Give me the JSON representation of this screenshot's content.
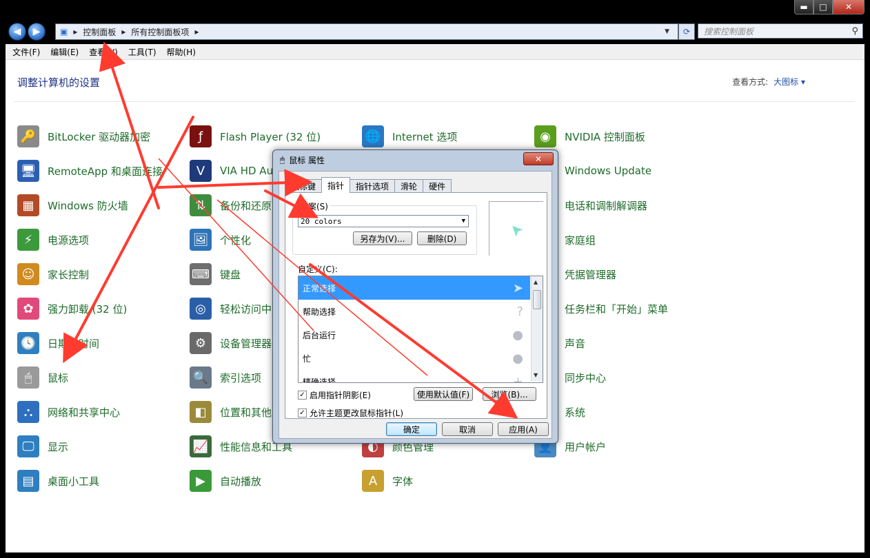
{
  "window": {
    "min_glyph": "▬",
    "max_glyph": "□",
    "close_glyph": "✕"
  },
  "nav": {
    "back_glyph": "◀",
    "forward_glyph": "▶",
    "refresh_glyph": "⟳",
    "breadcrumb": [
      "控制面板",
      "所有控制面板项"
    ],
    "search_placeholder": "搜索控制面板"
  },
  "menu": [
    "文件(F)",
    "编辑(E)",
    "查看(V)",
    "工具(T)",
    "帮助(H)"
  ],
  "header": {
    "title": "调整计算机的设置",
    "view_label": "查看方式:",
    "view_value": "大图标 ▾"
  },
  "items": [
    {
      "label": "BitLocker 驱动器加密",
      "icon": "key-lock-icon",
      "glyph": "🔑",
      "color": "#8a8a8a"
    },
    {
      "label": "Flash Player (32 位)",
      "icon": "flash-icon",
      "glyph": "ƒ",
      "color": "#7a1010"
    },
    {
      "label": "Internet 选项",
      "icon": "globe-icon",
      "glyph": "🌐",
      "color": "#2a78c4"
    },
    {
      "label": "NVIDIA 控制面板",
      "icon": "nvidia-icon",
      "glyph": "◉",
      "color": "#5a9e1c"
    },
    {
      "label": "RemoteApp 和桌面连接",
      "icon": "remote-desktop-icon",
      "glyph": "🖥",
      "color": "#2b5fb3"
    },
    {
      "label": "VIA HD Au",
      "icon": "via-audio-icon",
      "glyph": "V",
      "color": "#1f3a7a"
    },
    {
      "label": "",
      "icon": "hidden-icon",
      "glyph": "",
      "color": "#ffffff"
    },
    {
      "label": "Windows Update",
      "icon": "windows-update-icon",
      "glyph": "⟲",
      "color": "#4b8a2c"
    },
    {
      "label": "Windows 防火墙",
      "icon": "firewall-icon",
      "glyph": "▦",
      "color": "#b34a26"
    },
    {
      "label": "备份和还原",
      "icon": "backup-icon",
      "glyph": "⇅",
      "color": "#3f8c3f"
    },
    {
      "label": "",
      "icon": "hidden-icon",
      "glyph": "",
      "color": "#ffffff"
    },
    {
      "label": "电话和调制解调器",
      "icon": "phone-icon",
      "glyph": "☎",
      "color": "#777777"
    },
    {
      "label": "电源选项",
      "icon": "power-icon",
      "glyph": "⚡",
      "color": "#3c9a3c"
    },
    {
      "label": "个性化",
      "icon": "personalize-icon",
      "glyph": "🖼",
      "color": "#2e74b8"
    },
    {
      "label": "",
      "icon": "hidden-icon",
      "glyph": "",
      "color": "#ffffff"
    },
    {
      "label": "家庭组",
      "icon": "homegroup-icon",
      "glyph": "⌂",
      "color": "#2f7fc0"
    },
    {
      "label": "家长控制",
      "icon": "parental-icon",
      "glyph": "☺",
      "color": "#d18a1e"
    },
    {
      "label": "键盘",
      "icon": "keyboard-icon",
      "glyph": "⌨",
      "color": "#6e6e6e"
    },
    {
      "label": "",
      "icon": "hidden-icon",
      "glyph": "",
      "color": "#ffffff"
    },
    {
      "label": "凭据管理器",
      "icon": "credential-icon",
      "glyph": "🗝",
      "color": "#b88a2a"
    },
    {
      "label": "强力卸载 (32 位)",
      "icon": "uninstall-icon",
      "glyph": "✿",
      "color": "#e04a7a"
    },
    {
      "label": "轻松访问中",
      "icon": "ease-access-icon",
      "glyph": "◎",
      "color": "#2a5fa8"
    },
    {
      "label": "",
      "icon": "hidden-icon",
      "glyph": "",
      "color": "#ffffff"
    },
    {
      "label": "任务栏和「开始」菜单",
      "icon": "taskbar-icon",
      "glyph": "▭",
      "color": "#4a6a9a"
    },
    {
      "label": "日期和时间",
      "icon": "clock-icon",
      "glyph": "🕓",
      "color": "#2f7fc0"
    },
    {
      "label": "设备管理器",
      "icon": "device-manager-icon",
      "glyph": "⚙",
      "color": "#6a6a6a"
    },
    {
      "label": "",
      "icon": "hidden-icon",
      "glyph": "",
      "color": "#ffffff"
    },
    {
      "label": "声音",
      "icon": "sound-icon",
      "glyph": "♪",
      "color": "#7a7a7a"
    },
    {
      "label": "鼠标",
      "icon": "mouse-icon",
      "glyph": "🖱",
      "color": "#9a9a9a"
    },
    {
      "label": "索引选项",
      "icon": "index-icon",
      "glyph": "🔍",
      "color": "#6a7a8a"
    },
    {
      "label": "",
      "icon": "hidden-icon",
      "glyph": "",
      "color": "#ffffff"
    },
    {
      "label": "同步中心",
      "icon": "sync-icon",
      "glyph": "⟳",
      "color": "#3a9a3a"
    },
    {
      "label": "网络和共享中心",
      "icon": "network-icon",
      "glyph": "⛬",
      "color": "#2f6fc0"
    },
    {
      "label": "位置和其他",
      "icon": "location-icon",
      "glyph": "◧",
      "color": "#9a8a3a"
    },
    {
      "label": "",
      "icon": "hidden-icon",
      "glyph": "",
      "color": "#ffffff"
    },
    {
      "label": "系统",
      "icon": "system-icon",
      "glyph": "▣",
      "color": "#4a7ab0"
    },
    {
      "label": "显示",
      "icon": "display-icon",
      "glyph": "🖵",
      "color": "#2f7fc0"
    },
    {
      "label": "性能信息和工具",
      "icon": "performance-icon",
      "glyph": "📈",
      "color": "#3a6a3a"
    },
    {
      "label": "颜色管理",
      "icon": "color-icon",
      "glyph": "◐",
      "color": "#c04040"
    },
    {
      "label": "用户帐户",
      "icon": "user-icon",
      "glyph": "👤",
      "color": "#4a8ac0"
    },
    {
      "label": "桌面小工具",
      "icon": "gadgets-icon",
      "glyph": "▤",
      "color": "#2f7fc0"
    },
    {
      "label": "自动播放",
      "icon": "autoplay-icon",
      "glyph": "▶",
      "color": "#3a9a3a"
    },
    {
      "label": "字体",
      "icon": "fonts-icon",
      "glyph": "A",
      "color": "#c8a030"
    }
  ],
  "dialog": {
    "title": "鼠标 属性",
    "title_icon": "🖱",
    "close_glyph": "✕",
    "tabs": [
      "鼠标键",
      "指针",
      "指针选项",
      "滑轮",
      "硬件"
    ],
    "scheme_label": "方案(S)",
    "scheme_value": "20 colors",
    "save_as": "另存为(V)...",
    "delete": "删除(D)",
    "preview_cursor": "➤",
    "customize_label": "自定义(C):",
    "cursor_rows": [
      {
        "label": "正常选择",
        "glyph": "➤"
      },
      {
        "label": "帮助选择",
        "glyph": "?"
      },
      {
        "label": "后台运行",
        "glyph": "●"
      },
      {
        "label": "忙",
        "glyph": "●"
      },
      {
        "label": "精确选择",
        "glyph": "+"
      }
    ],
    "shadow_check": "启用指针阴影(E)",
    "theme_check": "允许主题更改鼠标指针(L)",
    "check_glyph": "✓",
    "use_default": "使用默认值(F)",
    "browse": "浏览(B)...",
    "ok": "确定",
    "cancel": "取消",
    "apply": "应用(A)"
  }
}
